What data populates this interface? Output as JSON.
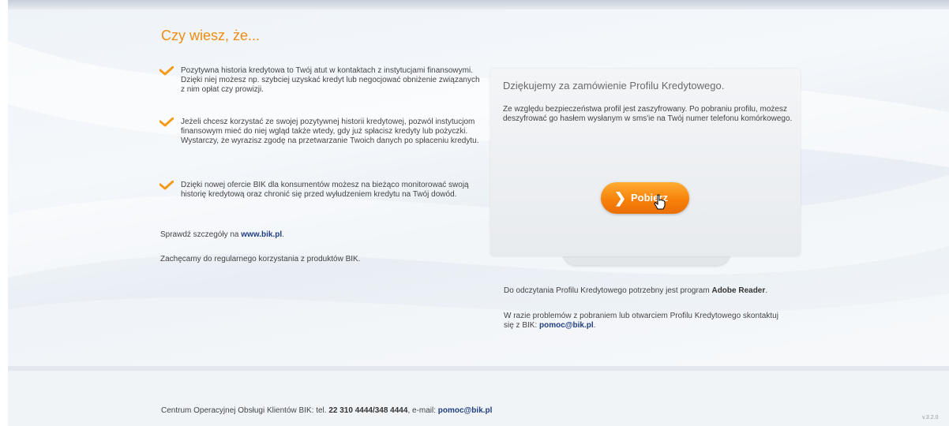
{
  "header": {
    "title": "Czy wiesz, że..."
  },
  "tips": [
    {
      "text": "Pozytywna historia kredytowa to Twój atut w kontaktach z instytucjami finansowymi. Dzięki niej możesz np. szybciej uzyskać kredyt lub negocjować obniżenie związanych z nim opłat czy prowizji."
    },
    {
      "text": "Jeżeli chcesz korzystać ze swojej pozytywnej historii kredytowej, pozwól instytucjom finansowym mieć do niej wgląd także wtedy, gdy już spłacisz kredyty lub pożyczki. Wystarczy, że wyrazisz zgodę na przetwarzanie Twoich danych po spłaceniu kredytu."
    },
    {
      "text": "Dzięki nowej ofercie BIK dla konsumentów możesz na bieżąco monitorować swoją historię kredytową oraz chronić się przed wyłudzeniem kredytu na Twój dowód."
    }
  ],
  "details": {
    "prefix": "Sprawdź szczegóły na ",
    "link": "www.bik.pl",
    "suffix": "."
  },
  "encourage": "Zachęcamy do regularnego korzystania z produktów BIK.",
  "card": {
    "title": "Dziękujemy za zamówienie Profilu Kredytowego.",
    "text": "Ze względu bezpieczeństwa profil jest zaszyfrowany. Po pobraniu profilu, możesz deszyfrować go hasłem wysłanym w sms'ie na Twój numer telefonu komórkowego.",
    "button_label": "Pobierz"
  },
  "reader_note": {
    "prefix": "Do odczytania Profilu Kredytowego potrzebny jest program ",
    "program": "Adobe Reader",
    "suffix": "."
  },
  "problems_note": {
    "prefix": "W razie problemów z pobraniem lub otwarciem Profilu Kredytowego skontaktuj się z BIK: ",
    "email": "pomoc@bik.pl",
    "suffix": "."
  },
  "footer": {
    "prefix": "Centrum Operacyjnej Obsługi Klientów BIK: tel. ",
    "phone": "22 310 4444/348 4444",
    "middle": ", e-mail: ",
    "email": "pomoc@bik.pl",
    "version": "v.3.2.0"
  },
  "colors": {
    "accent": "#f08c12",
    "link": "#1f3f80",
    "button": "#f7820b"
  },
  "icons": {
    "tip": "checkmark-icon",
    "button": "chevron-right-icon",
    "pointer": "hand-cursor-icon"
  }
}
